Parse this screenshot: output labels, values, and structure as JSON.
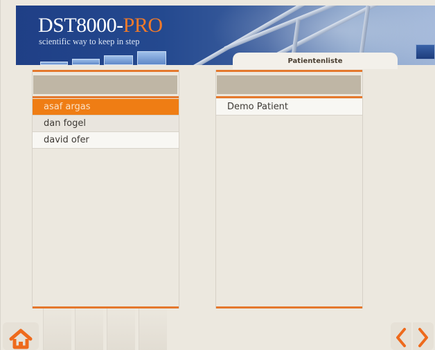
{
  "header": {
    "logo_main": "DST8000-",
    "logo_accent": "PRO",
    "tagline": "scientific way to keep in step",
    "brand_color": "#1f3f86",
    "accent_color": "#f17a2a"
  },
  "tab": {
    "label": "Patientenliste"
  },
  "left_list": {
    "items": [
      "asaf argas",
      "dan fogel",
      "david ofer"
    ],
    "selected_index": 0
  },
  "right_list": {
    "items": [
      "Demo Patient"
    ]
  },
  "icons": {
    "home": "home-icon",
    "back": "chevron-left-icon",
    "next": "chevron-right-icon"
  },
  "colors": {
    "highlight": "#ef7d14",
    "rule": "#e4782d",
    "header_bar": "#bfb6a5"
  }
}
